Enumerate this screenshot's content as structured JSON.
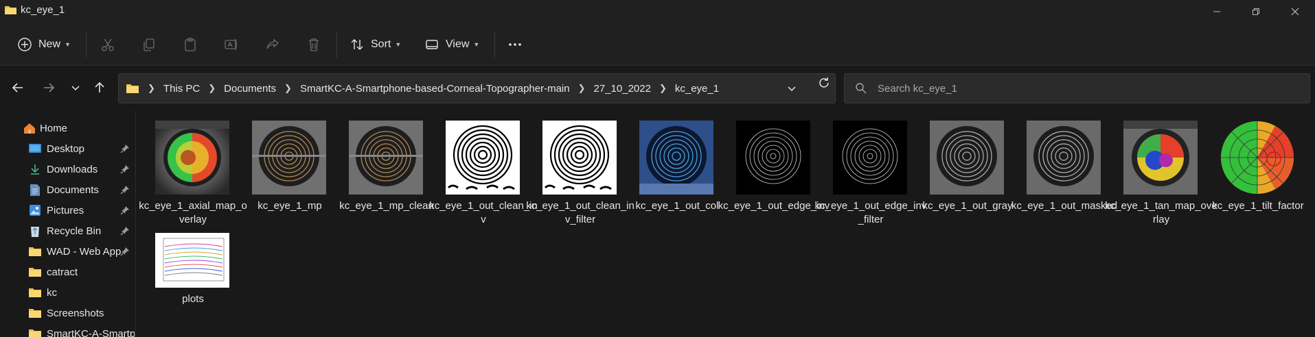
{
  "window": {
    "title": "kc_eye_1"
  },
  "toolbar": {
    "new_label": "New",
    "sort_label": "Sort",
    "view_label": "View",
    "icons": [
      "plus-circle-icon",
      "cut-icon",
      "copy-icon",
      "paste-icon",
      "rename-icon",
      "share-icon",
      "delete-icon",
      "sort-icon",
      "view-icon",
      "more-icon"
    ]
  },
  "address": {
    "crumbs": [
      "This PC",
      "Documents",
      "SmartKC-A-Smartphone-based-Corneal-Topographer-main",
      "27_10_2022",
      "kc_eye_1"
    ]
  },
  "search": {
    "placeholder": "Search kc_eye_1"
  },
  "sidebar": {
    "items": [
      {
        "label": "Home",
        "icon": "home-icon",
        "pinned": false
      },
      {
        "label": "Desktop",
        "icon": "desktop-icon",
        "pinned": true
      },
      {
        "label": "Downloads",
        "icon": "download-icon",
        "pinned": true
      },
      {
        "label": "Documents",
        "icon": "documents-icon",
        "pinned": true
      },
      {
        "label": "Pictures",
        "icon": "pictures-icon",
        "pinned": true
      },
      {
        "label": "Recycle Bin",
        "icon": "recycle-bin-icon",
        "pinned": true
      },
      {
        "label": "WAD - Web App",
        "icon": "folder-icon",
        "pinned": true
      },
      {
        "label": "catract",
        "icon": "folder-icon",
        "pinned": false
      },
      {
        "label": "kc",
        "icon": "folder-icon",
        "pinned": false
      },
      {
        "label": "Screenshots",
        "icon": "folder-icon",
        "pinned": false
      },
      {
        "label": "SmartKC-A-Smartp",
        "icon": "folder-icon",
        "pinned": false
      }
    ]
  },
  "files": [
    {
      "name": "kc_eye_1_axial_map_overlay",
      "thumb": "axial-map"
    },
    {
      "name": "kc_eye_1_mp",
      "thumb": "eye-brown"
    },
    {
      "name": "kc_eye_1_mp_clean",
      "thumb": "eye-brown"
    },
    {
      "name": "kc_eye_1_out_clean_inv",
      "thumb": "rings-white"
    },
    {
      "name": "kc_eye_1_out_clean_inv_filter",
      "thumb": "rings-white"
    },
    {
      "name": "kc_eye_1_out_col",
      "thumb": "eye-blue"
    },
    {
      "name": "kc_eye_1_out_edge_inv",
      "thumb": "rings-black"
    },
    {
      "name": "kc_eye_1_out_edge_inv_filter",
      "thumb": "rings-black"
    },
    {
      "name": "kc_eye_1_out_gray",
      "thumb": "eye-gray"
    },
    {
      "name": "kc_eye_1_out_masked",
      "thumb": "eye-gray"
    },
    {
      "name": "kc_eye_1_tan_map_overlay",
      "thumb": "tan-map"
    },
    {
      "name": "kc_eye_1_tilt_factor",
      "thumb": "tilt-map"
    },
    {
      "name": "plots",
      "thumb": "plot"
    }
  ],
  "colors": {
    "folder": "#f0c14b",
    "accent": "#4ca0e0",
    "background": "#191919"
  }
}
